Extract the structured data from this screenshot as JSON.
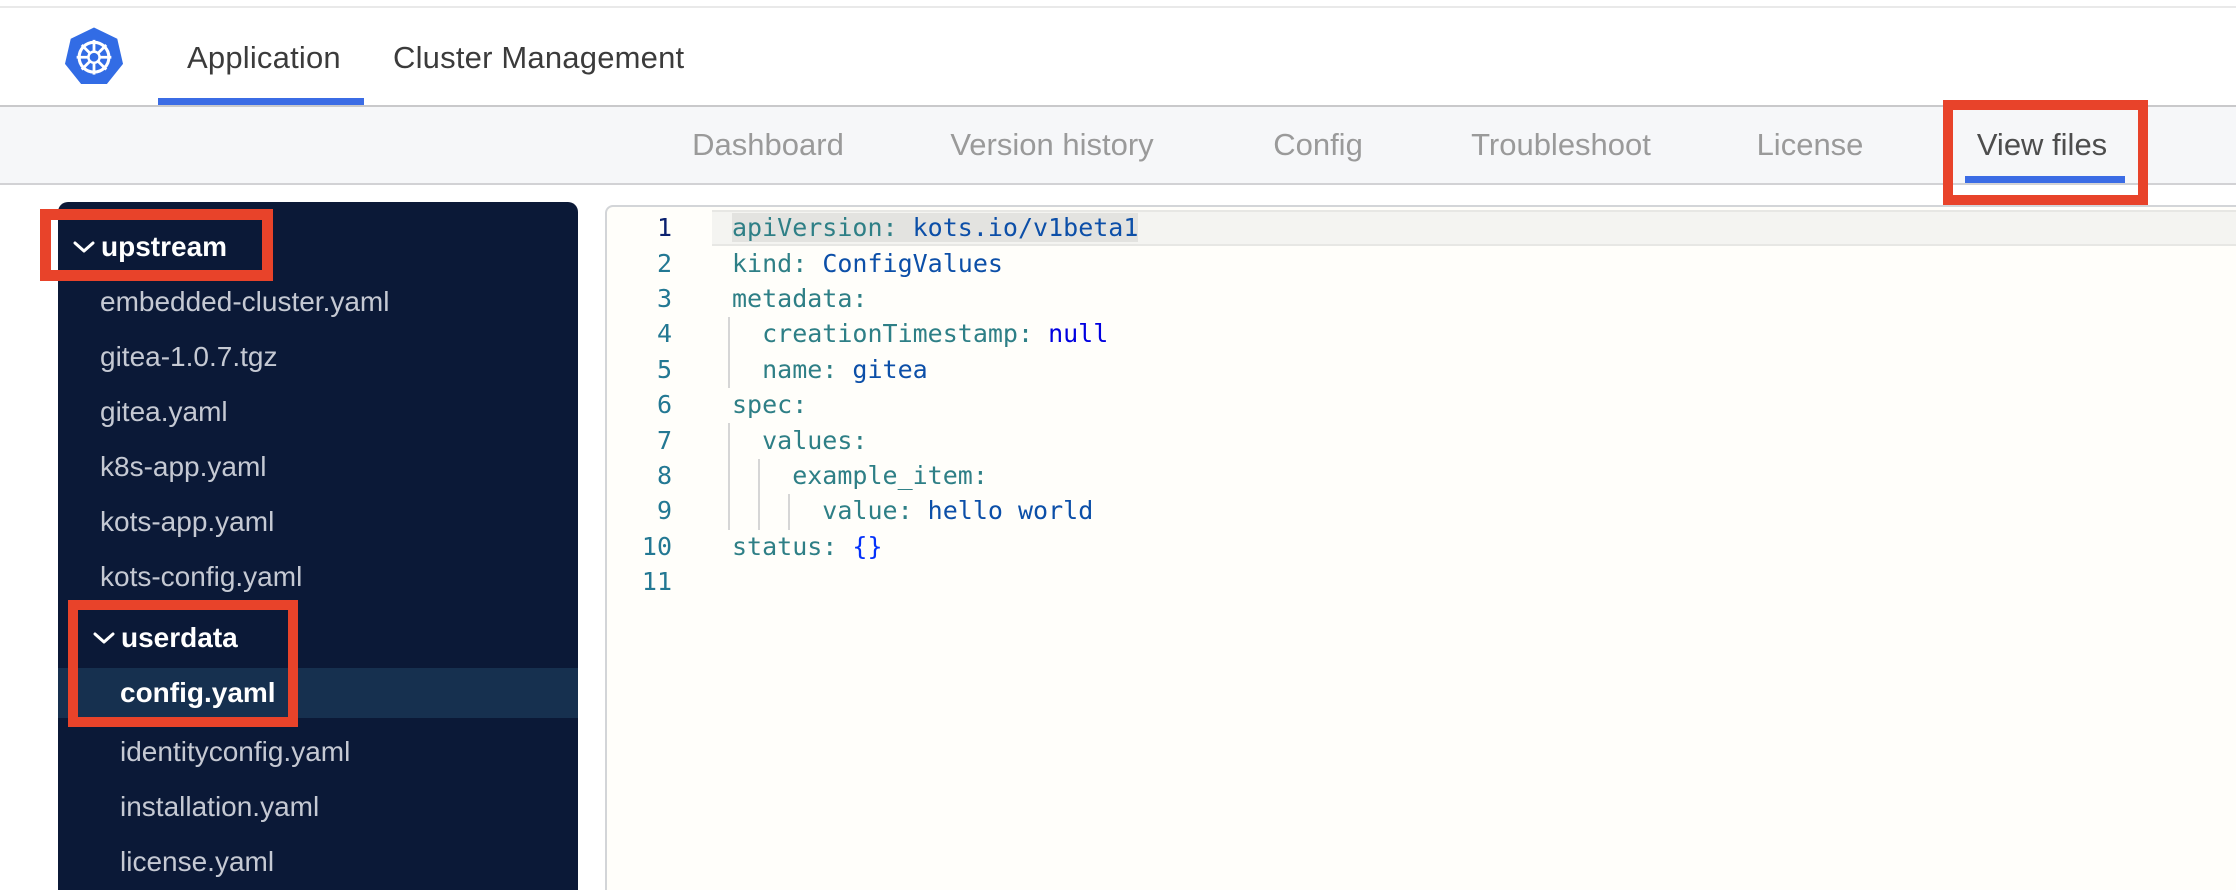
{
  "header": {
    "logo": "kubernetes-logo",
    "tabs": [
      {
        "label": "Application",
        "active": true
      },
      {
        "label": "Cluster Management",
        "active": false
      }
    ]
  },
  "subnav": {
    "items": [
      {
        "label": "Dashboard",
        "active": false
      },
      {
        "label": "Version history",
        "active": false
      },
      {
        "label": "Config",
        "active": false
      },
      {
        "label": "Troubleshoot",
        "active": false
      },
      {
        "label": "License",
        "active": false
      },
      {
        "label": "View files",
        "active": true
      }
    ]
  },
  "file_tree": {
    "items": [
      {
        "name": "upstream",
        "type": "folder",
        "level": 0,
        "expanded": true,
        "annotated": true
      },
      {
        "name": "embedded-cluster.yaml",
        "type": "file",
        "level": 1
      },
      {
        "name": "gitea-1.0.7.tgz",
        "type": "file",
        "level": 1
      },
      {
        "name": "gitea.yaml",
        "type": "file",
        "level": 1
      },
      {
        "name": "k8s-app.yaml",
        "type": "file",
        "level": 1
      },
      {
        "name": "kots-app.yaml",
        "type": "file",
        "level": 1
      },
      {
        "name": "kots-config.yaml",
        "type": "file",
        "level": 1
      },
      {
        "name": "userdata",
        "type": "folder",
        "level": 1,
        "expanded": true,
        "annotated": true
      },
      {
        "name": "config.yaml",
        "type": "file",
        "level": 2,
        "selected": true,
        "annotated": true
      },
      {
        "name": "identityconfig.yaml",
        "type": "file",
        "level": 2
      },
      {
        "name": "installation.yaml",
        "type": "file",
        "level": 2
      },
      {
        "name": "license.yaml",
        "type": "file",
        "level": 2
      }
    ]
  },
  "editor": {
    "selected_file": "config.yaml",
    "lines": [
      {
        "num": "1",
        "key": "apiVersion:",
        "value": " kots.io/v1beta1",
        "value_type": "string",
        "active": true,
        "selected": true
      },
      {
        "num": "2",
        "key": "kind:",
        "value": " ConfigValues",
        "value_type": "string"
      },
      {
        "num": "3",
        "key": "metadata:",
        "value": ""
      },
      {
        "num": "4",
        "key": "  creationTimestamp:",
        "value": " null",
        "value_type": "keyword"
      },
      {
        "num": "5",
        "key": "  name:",
        "value": " gitea",
        "value_type": "string"
      },
      {
        "num": "6",
        "key": "spec:",
        "value": ""
      },
      {
        "num": "7",
        "key": "  values:",
        "value": ""
      },
      {
        "num": "8",
        "key": "    example_item:",
        "value": ""
      },
      {
        "num": "9",
        "key": "      value:",
        "value": " hello world",
        "value_type": "string"
      },
      {
        "num": "10",
        "key": "status:",
        "value": " {}",
        "value_type": "bracket"
      },
      {
        "num": "11",
        "key": "",
        "value": ""
      }
    ]
  },
  "annotations": {
    "color": "#e8432a",
    "boxes": [
      "upstream-folder",
      "userdata-folder-and-config-yaml",
      "view-files-tab"
    ]
  },
  "colors": {
    "kubernetes_blue": "#326ce5",
    "active_tab_underline": "#3b6ce5",
    "sidebar_bg": "#0b1937",
    "sidebar_selected_row": "#16304f",
    "sidebar_file_text": "#c5c9d3",
    "editor_bg": "#fffefa",
    "yaml_key": "#2e7f86",
    "yaml_string": "#0c4fa8",
    "yaml_keyword": "#0000e0",
    "line_number": "#237893",
    "annotation_red": "#e8432a"
  }
}
